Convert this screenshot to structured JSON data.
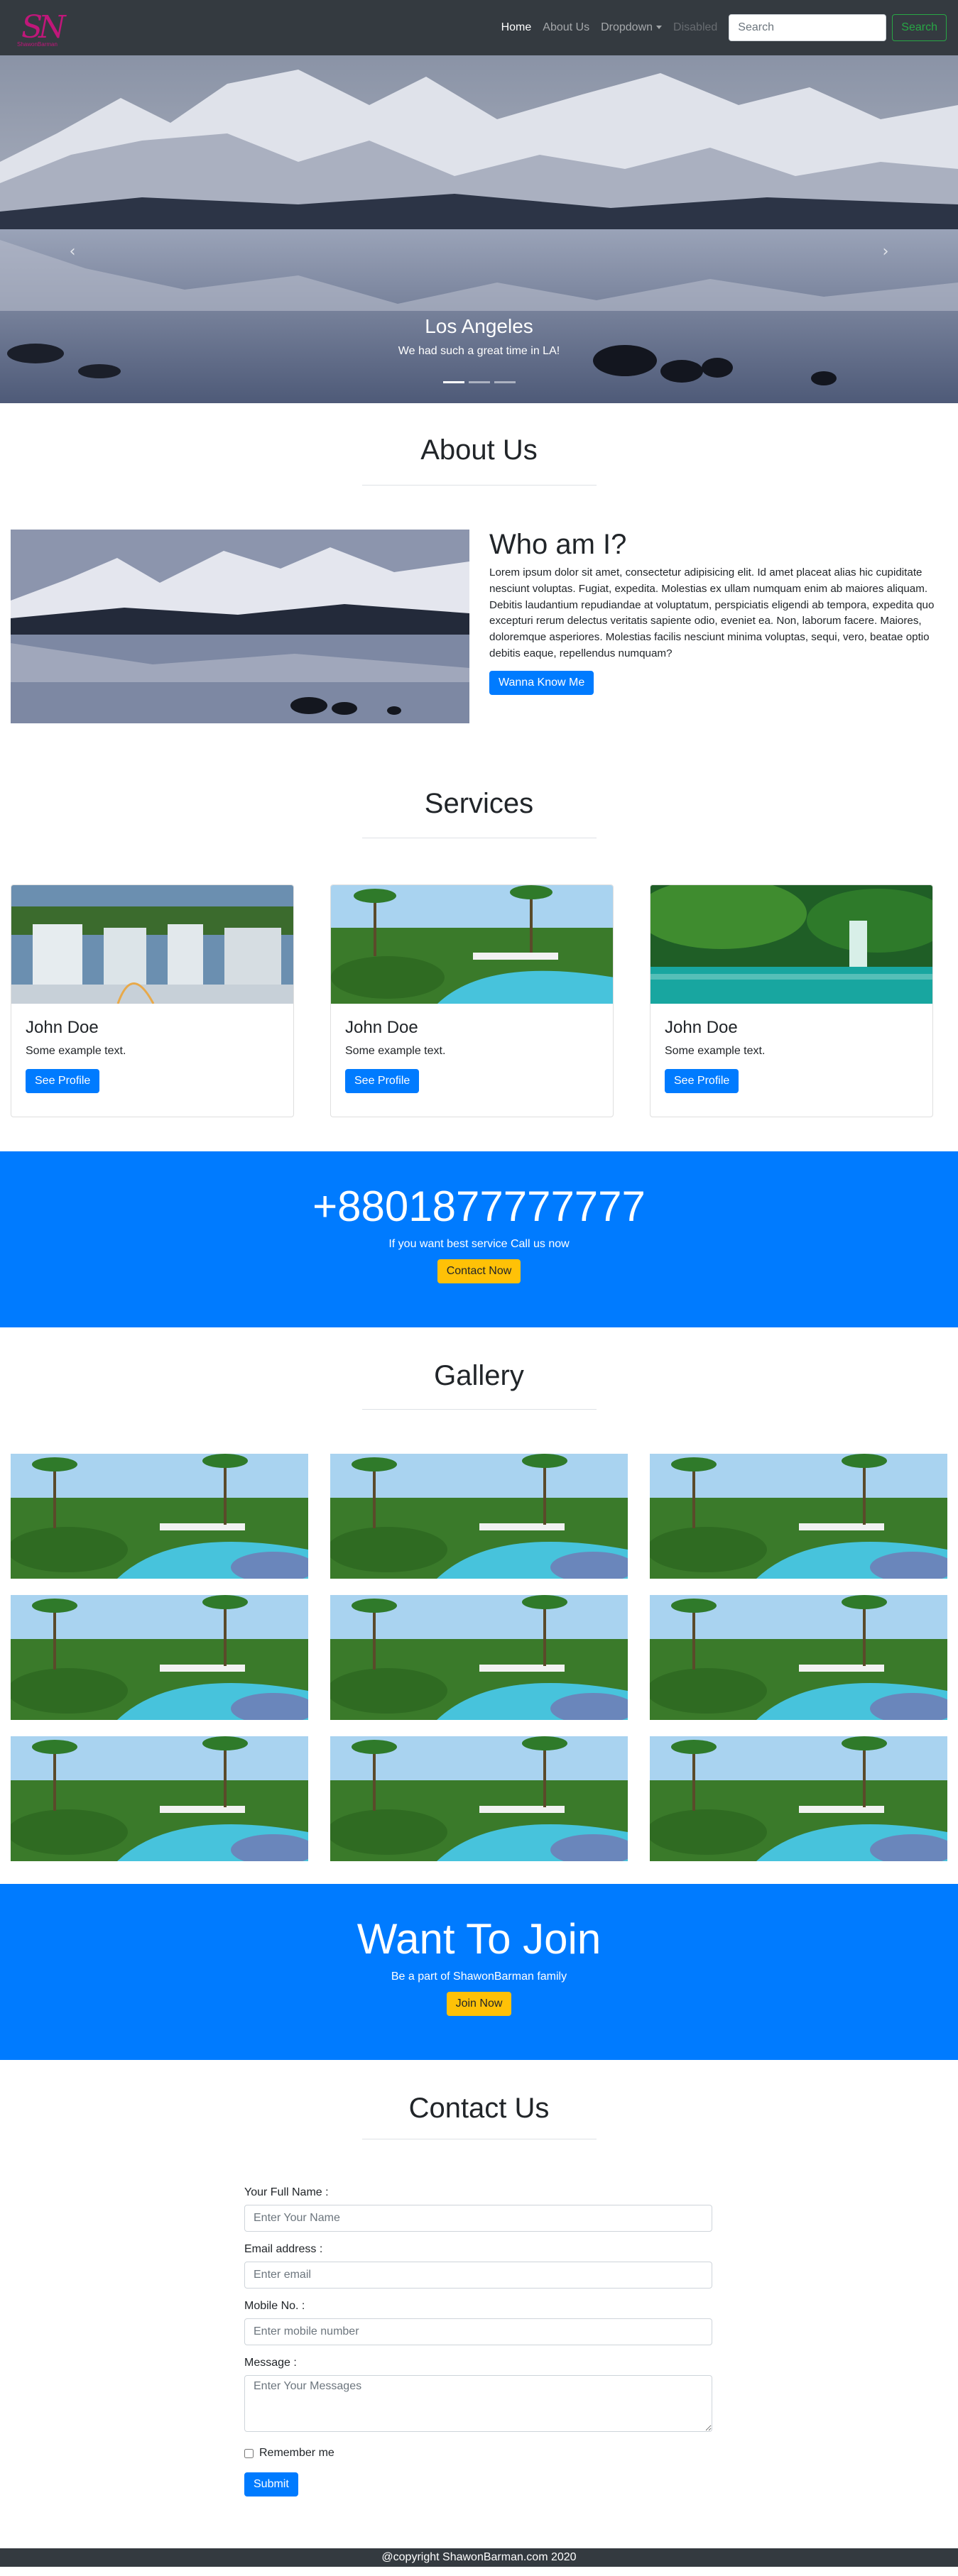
{
  "navbar": {
    "brand_letters": "SN",
    "brand_tagline": "ShawonBarman",
    "links": [
      {
        "label": "Home"
      },
      {
        "label": "About Us"
      },
      {
        "label": "Dropdown"
      },
      {
        "label": "Disabled"
      }
    ],
    "search_placeholder": "Search",
    "search_button": "Search"
  },
  "carousel": {
    "caption_title": "Los Angeles",
    "caption_text": "We had such a great time in LA!",
    "prev_icon": "‹",
    "next_icon": "›",
    "slide_count": 3,
    "active_slide": 1
  },
  "about": {
    "title": "About Us",
    "heading": "Who am I?",
    "text": "Lorem ipsum dolor sit amet, consectetur adipisicing elit. Id amet placeat alias hic cupiditate nesciunt voluptas. Fugiat, expedita. Molestias ex ullam numquam enim ab maiores aliquam. Debitis laudantium repudiandae at voluptatum, perspiciatis eligendi ab tempora, expedita quo excepturi rerum delectus veritatis sapiente odio, eveniet ea. Non, laborum facere. Maiores, doloremque asperiores. Molestias facilis nesciunt minima voluptas, sequi, vero, beatae optio debitis eaque, repellendus numquam?",
    "button": "Wanna Know Me"
  },
  "services": {
    "title": "Services",
    "cards": [
      {
        "name": "John Doe",
        "text": "Some example text.",
        "button": "See Profile"
      },
      {
        "name": "John Doe",
        "text": "Some example text.",
        "button": "See Profile"
      },
      {
        "name": "John Doe",
        "text": "Some example text.",
        "button": "See Profile"
      }
    ]
  },
  "call": {
    "phone": "+8801877777777",
    "text": "If you want best service Call us now",
    "button": "Contact Now"
  },
  "gallery": {
    "title": "Gallery",
    "image_count": 9
  },
  "join": {
    "title": "Want To Join",
    "text": "Be a part of ShawonBarman family",
    "button": "Join Now"
  },
  "contact": {
    "title": "Contact Us",
    "name_label": "Your Full Name :",
    "name_placeholder": "Enter Your Name",
    "email_label": "Email address :",
    "email_placeholder": "Enter email",
    "mobile_label": "Mobile No. :",
    "mobile_placeholder": "Enter mobile number",
    "message_label": "Message :",
    "message_placeholder": "Enter Your Messages",
    "remember_label": "Remember me",
    "submit": "Submit"
  },
  "footer": {
    "text": "@copyright ShawonBarman.com 2020"
  },
  "colors": {
    "navbar_bg": "#343a40",
    "primary": "#007bff",
    "warning": "#ffc107",
    "success": "#28a745"
  }
}
